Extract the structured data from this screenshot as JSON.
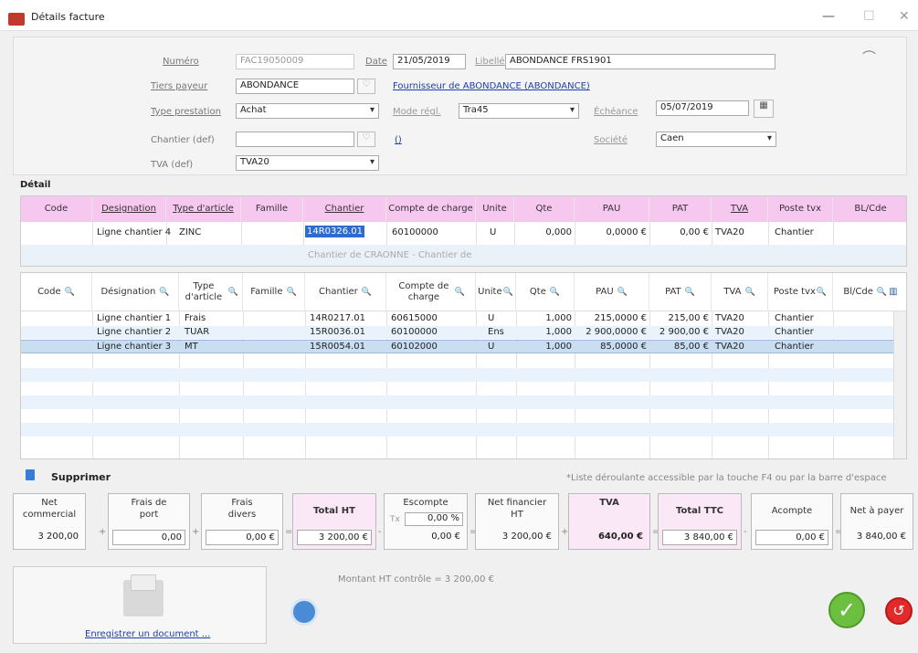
{
  "window": {
    "title": "Détails facture",
    "min": "—",
    "max": "☐",
    "close": "✕"
  },
  "form": {
    "numero": {
      "label": "Numéro",
      "value": "FAC19050009"
    },
    "date": {
      "label": "Date",
      "value": "21/05/2019"
    },
    "libelle": {
      "label": "Libellé",
      "value": "ABONDANCE FRS1901"
    },
    "tiers": {
      "label": "Tiers payeur",
      "value": "ABONDANCE",
      "link": "Fournisseur de ABONDANCE (ABONDANCE)"
    },
    "type_prestation": {
      "label": "Type prestation",
      "value": "Achat"
    },
    "mode_regl": {
      "label": "Mode régl.",
      "value": "Tra45"
    },
    "echeance": {
      "label": "Échéance",
      "value": "05/07/2019"
    },
    "chantier_def": {
      "label": "Chantier (def)",
      "value": "",
      "link": "()"
    },
    "societe": {
      "label": "Société",
      "value": "Caen"
    },
    "tva_def": {
      "label": "TVA (def)",
      "value": "TVA20"
    }
  },
  "section_label": "Détail",
  "edit_table": {
    "headers": [
      "Code",
      "Designation",
      "Type d'article",
      "Famille",
      "Chantier",
      "Compte de charge",
      "Unite",
      "Qte",
      "PAU",
      "PAT",
      "TVA",
      "Poste tvx",
      "BL/Cde"
    ],
    "row": [
      "",
      "Ligne chantier 4",
      "ZINC",
      "",
      "14R0326.01",
      "60100000",
      "U",
      "0,000",
      "0,0000 €",
      "0,00 €",
      "TVA20",
      "Chantier",
      ""
    ],
    "hint": "Chantier de CRAONNE - Chantier de"
  },
  "grid": {
    "headers": [
      "Code",
      "Désignation",
      "Type d'article",
      "Famille",
      "Chantier",
      "Compte de charge",
      "Unite",
      "Qte",
      "PAU",
      "PAT",
      "TVA",
      "Poste tvx",
      "Bl/Cde"
    ],
    "rows": [
      [
        "",
        "Ligne chantier 1",
        "Frais",
        "",
        "14R0217.01",
        "60615000",
        "U",
        "1,000",
        "215,0000 €",
        "215,00 €",
        "TVA20",
        "Chantier",
        ""
      ],
      [
        "",
        "Ligne chantier 2",
        "TUAR",
        "",
        "15R0036.01",
        "60100000",
        "Ens",
        "1,000",
        "2 900,0000 €",
        "2 900,00 €",
        "TVA20",
        "Chantier",
        ""
      ],
      [
        "",
        "Ligne chantier 3",
        "MT",
        "",
        "15R0054.01",
        "60102000",
        "U",
        "1,000",
        "85,0000 €",
        "85,00 €",
        "TVA20",
        "Chantier",
        ""
      ]
    ]
  },
  "actions": {
    "delete": "Supprimer",
    "hint": "*Liste déroulante accessible par la touche F4 ou par la barre d'espace"
  },
  "summary": {
    "net_commercial": {
      "label": "Net commercial",
      "value": "3 200,00"
    },
    "frais_port": {
      "label": "Frais de port",
      "value": "0,00"
    },
    "frais_divers": {
      "label": "Frais divers",
      "value": "0,00 €"
    },
    "total_ht": {
      "label": "Total HT",
      "value": "3 200,00 €"
    },
    "escompte": {
      "label": "Escompte",
      "tx_label": "Tx",
      "tx": "0,00 %",
      "value": "0,00 €"
    },
    "net_financier": {
      "label": "Net financier HT",
      "value": "3 200,00 €"
    },
    "tva": {
      "label": "TVA",
      "value": "640,00 €"
    },
    "total_ttc": {
      "label": "Total TTC",
      "value": "3 840,00 €"
    },
    "acompte": {
      "label": "Acompte",
      "value": "0,00 €"
    },
    "net_payer": {
      "label": "Net à payer",
      "value": "3 840,00 €"
    }
  },
  "footer": {
    "register_doc": "Enregistrer un document ...",
    "control": "Montant HT contrôle = 3 200,00 €"
  }
}
